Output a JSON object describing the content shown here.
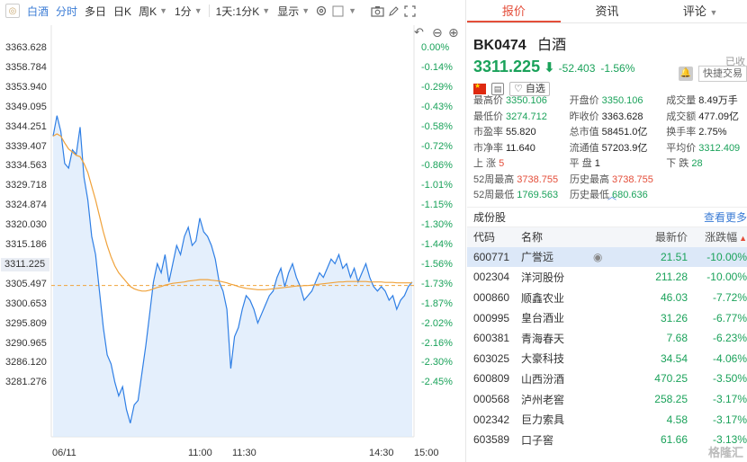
{
  "toolbar": {
    "stock_name": "白酒",
    "items": [
      "分时",
      "多日",
      "日K",
      "周K",
      "1分",
      "1天:1分K",
      "显示"
    ]
  },
  "chart": {
    "prev_close_label": "3311.225",
    "y_ticks": [
      "3363.628",
      "3358.784",
      "3353.940",
      "3349.095",
      "3344.251",
      "3339.407",
      "3334.563",
      "3329.718",
      "3324.874",
      "3320.030",
      "3315.186",
      "3311.225",
      "3305.497",
      "3300.653",
      "3295.809",
      "3290.965",
      "3286.120",
      "3281.276"
    ],
    "pct_ticks": [
      "0.00%",
      "-0.14%",
      "-0.29%",
      "-0.43%",
      "-0.58%",
      "-0.72%",
      "-0.86%",
      "-1.01%",
      "-1.15%",
      "-1.30%",
      "-1.44%",
      "-1.56%",
      "-1.73%",
      "-1.87%",
      "-2.02%",
      "-2.16%",
      "-2.30%",
      "-2.45%"
    ],
    "time_labels": [
      "06/11",
      "11:00",
      "11:30",
      "14:30",
      "15:00"
    ],
    "colors": {
      "price_line": "#2f7fe5",
      "avg_line": "#f0a23a",
      "fill": "#dbe9fb",
      "ref_line": "#f0a23a"
    }
  },
  "chart_data": {
    "type": "area",
    "title": "",
    "xlabel": "",
    "ylabel": "",
    "ylim": [
      3278.0,
      3366.0
    ],
    "prev_close": 3311.225,
    "series": [
      {
        "name": "",
        "values": [
          3344.0,
          3348.5,
          3345.0,
          3338.0,
          3337.0,
          3341.0,
          3340.0,
          3346.0,
          3335.0,
          3330.0,
          3322.0,
          3318.0,
          3310.0,
          3302.0,
          3296.0,
          3294.0,
          3290.0,
          3287.0,
          3289.0,
          3284.0,
          3281.0,
          3285.0,
          3286.0,
          3292.0,
          3298.0,
          3305.0,
          3312.0,
          3316.0,
          3314.0,
          3318.0,
          3312.0,
          3316.0,
          3320.0,
          3318.0,
          3322.0,
          3324.0,
          3320.0,
          3321.0,
          3326.0,
          3323.0,
          3322.0,
          3320.0,
          3317.0,
          3312.0,
          3310.0,
          3306.0,
          3293.0,
          3300.0,
          3302.0,
          3306.0,
          3309.0,
          3308.0,
          3306.0,
          3303.0,
          3305.0,
          3307.0,
          3309.0,
          3310.0,
          3313.0,
          3315.0,
          3311.0,
          3314.0,
          3316.0,
          3313.0,
          3311.0,
          3308.0,
          3309.0,
          3310.0,
          3312.0,
          3314.0,
          3313.0,
          3315.0,
          3317.0,
          3316.0,
          3318.0,
          3315.0,
          3316.0,
          3313.0,
          3315.0,
          3312.0,
          3314.0,
          3316.0,
          3313.0,
          3311.0,
          3310.0,
          3311.0,
          3310.0,
          3308.0,
          3309.0,
          3306.0,
          3308.0,
          3309.0,
          3311.0,
          3312.0
        ]
      },
      {
        "name": "",
        "values": [
          3344.0,
          3344.5,
          3344.0,
          3342.5,
          3341.2,
          3340.5,
          3339.8,
          3339.5,
          3338.0,
          3336.0,
          3333.0,
          3330.0,
          3326.5,
          3323.0,
          3320.0,
          3317.5,
          3315.5,
          3314.0,
          3313.0,
          3312.0,
          3311.0,
          3310.5,
          3310.2,
          3310.0,
          3310.0,
          3310.2,
          3310.5,
          3310.8,
          3311.0,
          3311.3,
          3311.5,
          3311.7,
          3311.8,
          3311.9,
          3312.0,
          3312.2,
          3312.3,
          3312.4,
          3312.5,
          3312.5,
          3312.5,
          3312.4,
          3312.3,
          3312.2,
          3312.0,
          3311.8,
          3311.5,
          3311.3,
          3311.0,
          3310.8,
          3310.6,
          3310.5,
          3310.4,
          3310.3,
          3310.3,
          3310.3,
          3310.4,
          3310.5,
          3310.6,
          3310.7,
          3310.8,
          3310.9,
          3311.0,
          3311.1,
          3311.1,
          3311.2,
          3311.2,
          3311.3,
          3311.4,
          3311.5,
          3311.6,
          3311.7,
          3311.8,
          3311.9,
          3312.0,
          3312.0,
          3312.1,
          3312.1,
          3312.1,
          3312.1,
          3312.1,
          3312.1,
          3312.0,
          3312.0,
          3312.0,
          3312.0,
          3311.9,
          3311.9,
          3311.9,
          3311.8,
          3311.8,
          3311.8,
          3311.8,
          3311.8
        ]
      }
    ]
  },
  "tabs": [
    "报价",
    "资讯",
    "评论"
  ],
  "header": {
    "code": "BK0474",
    "name": "白酒",
    "price": "3311.225",
    "change": "-52.403",
    "change_pct": "-1.56%",
    "status": "已收",
    "fav_label": "自选",
    "quick_trade": "快捷交易"
  },
  "stats": [
    [
      {
        "l": "最高价",
        "v": "3350.106",
        "c": "green"
      },
      {
        "l": "开盘价",
        "v": "3350.106",
        "c": "green"
      },
      {
        "l": "成交量",
        "v": "8.49万手",
        "c": "dark"
      }
    ],
    [
      {
        "l": "最低价",
        "v": "3274.712",
        "c": "green"
      },
      {
        "l": "昨收价",
        "v": "3363.628",
        "c": "dark"
      },
      {
        "l": "成交额",
        "v": "477.09亿",
        "c": "dark"
      }
    ],
    [
      {
        "l": "市盈率",
        "v": "55.820",
        "c": "dark"
      },
      {
        "l": "总市值",
        "v": "58451.0亿",
        "c": "dark"
      },
      {
        "l": "换手率",
        "v": "2.75%",
        "c": "dark"
      }
    ],
    [
      {
        "l": "市净率",
        "v": "11.640",
        "c": "dark"
      },
      {
        "l": "流通值",
        "v": "57203.9亿",
        "c": "dark"
      },
      {
        "l": "平均价",
        "v": "3312.409",
        "c": "green"
      }
    ],
    [
      {
        "l": "上 涨",
        "v": "5",
        "c": "red"
      },
      {
        "l": "平 盘",
        "v": "1",
        "c": "dark"
      },
      {
        "l": "下 跌",
        "v": "28",
        "c": "green"
      }
    ],
    [
      {
        "l": "52周最高",
        "v": "3738.755",
        "c": "red"
      },
      {
        "l": "历史最高",
        "v": "3738.755",
        "c": "red"
      }
    ],
    [
      {
        "l": "52周最低",
        "v": "1769.563",
        "c": "green"
      },
      {
        "l": "历史最低",
        "v": "680.636",
        "c": "green"
      }
    ]
  ],
  "components": {
    "title": "成份股",
    "more": "查看更多",
    "headers": [
      "代码",
      "名称",
      "最新价",
      "涨跌幅"
    ],
    "rows": [
      {
        "code": "600771",
        "name": "广誉远",
        "last": "21.51",
        "pct": "-10.00%"
      },
      {
        "code": "002304",
        "name": "洋河股份",
        "last": "211.28",
        "pct": "-10.00%"
      },
      {
        "code": "000860",
        "name": "顺鑫农业",
        "last": "46.03",
        "pct": "-7.72%"
      },
      {
        "code": "000995",
        "name": "皇台酒业",
        "last": "31.26",
        "pct": "-6.77%"
      },
      {
        "code": "600381",
        "name": "青海春天",
        "last": "7.68",
        "pct": "-6.23%"
      },
      {
        "code": "603025",
        "name": "大豪科技",
        "last": "34.54",
        "pct": "-4.06%"
      },
      {
        "code": "600809",
        "name": "山西汾酒",
        "last": "470.25",
        "pct": "-3.50%"
      },
      {
        "code": "000568",
        "name": "泸州老窖",
        "last": "258.25",
        "pct": "-3.17%"
      },
      {
        "code": "002342",
        "name": "巨力索具",
        "last": "4.58",
        "pct": "-3.17%"
      },
      {
        "code": "603589",
        "name": "口子窖",
        "last": "61.66",
        "pct": "-3.13%"
      }
    ]
  },
  "watermark": "格隆汇"
}
